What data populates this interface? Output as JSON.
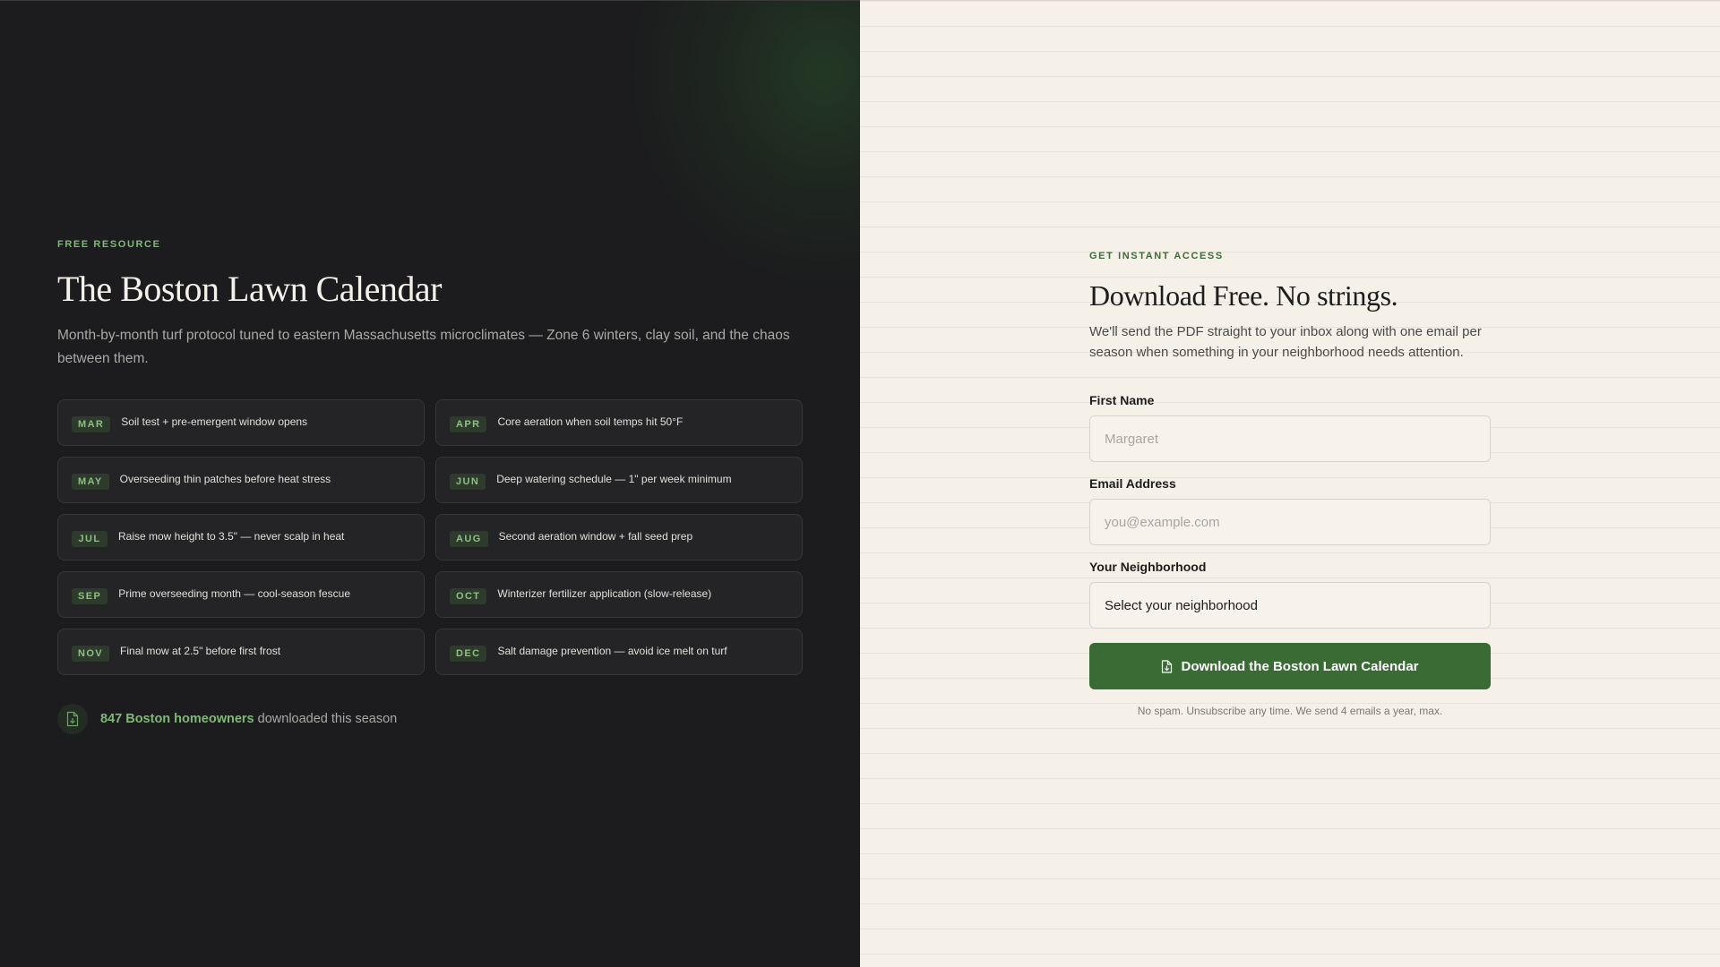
{
  "promo": {
    "eyebrow": "FREE RESOURCE",
    "title": "The Boston Lawn Calendar",
    "subtitle": "Month-by-month turf protocol tuned to eastern Massachusetts microclimates — Zone 6 winters, clay soil, and the chaos between them.",
    "months": [
      {
        "abbr": "MAR",
        "task": "Soil test + pre-emergent window opens"
      },
      {
        "abbr": "APR",
        "task": "Core aeration when soil temps hit 50°F"
      },
      {
        "abbr": "MAY",
        "task": "Overseeding thin patches before heat stress"
      },
      {
        "abbr": "JUN",
        "task": "Deep watering schedule — 1\" per week minimum"
      },
      {
        "abbr": "JUL",
        "task": "Raise mow height to 3.5\" — never scalp in heat"
      },
      {
        "abbr": "AUG",
        "task": "Second aeration window + fall seed prep"
      },
      {
        "abbr": "SEP",
        "task": "Prime overseeding month — cool-season fescue"
      },
      {
        "abbr": "OCT",
        "task": "Winterizer fertilizer application (slow-release)"
      },
      {
        "abbr": "NOV",
        "task": "Final mow at 2.5\" before first frost"
      },
      {
        "abbr": "DEC",
        "task": "Salt damage prevention — avoid ice melt on turf"
      }
    ],
    "social_proof": {
      "icon": "document-download-icon",
      "highlight": "847 Boston homeowners",
      "rest": " downloaded this season"
    }
  },
  "form": {
    "eyebrow": "GET INSTANT ACCESS",
    "title": "Download Free. No strings.",
    "description": "We'll send the PDF straight to your inbox along with one email per season when something in your neighborhood needs attention.",
    "first_name": {
      "label": "First Name",
      "placeholder": "Margaret",
      "value": ""
    },
    "email": {
      "label": "Email Address",
      "placeholder": "you@example.com",
      "value": ""
    },
    "neighborhood": {
      "label": "Your Neighborhood",
      "selected": "Select your neighborhood"
    },
    "submit": {
      "label": "Download the Boston Lawn Calendar",
      "icon": "document-download-icon"
    },
    "fine_print": "No spam. Unsubscribe any time. We send 4 emails a year, max."
  },
  "colors": {
    "left_bg": "#1c1c1e",
    "right_bg": "#f5f0e8",
    "accent_green": "#7fb876",
    "button_green": "#3a6b34"
  }
}
